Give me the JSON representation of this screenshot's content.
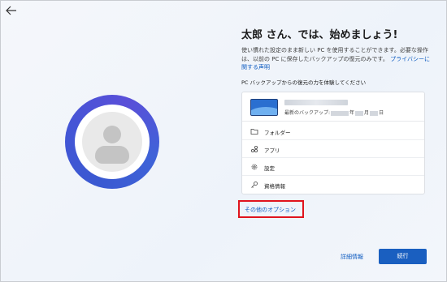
{
  "header": {
    "back_icon": "arrow-left-icon"
  },
  "main": {
    "title": "太郎 さん、では、始めましょう!",
    "description": "使い慣れた設定のまま新しい PC を使用することができます。必要な操作は、以前の PC に保存したバックアップの復元のみです。",
    "privacy_link": "プライバシーに関する声明",
    "section_label": "PC バックアップからの復元の力を体験してください"
  },
  "backup_card": {
    "backup_prefix": "最新のバックアップ:",
    "year_suffix": "年",
    "month_suffix": "月",
    "day_suffix": "日",
    "items": [
      {
        "label": "フォルダー",
        "icon": "folder-icon"
      },
      {
        "label": "アプリ",
        "icon": "apps-icon"
      },
      {
        "label": "設定",
        "icon": "gear-icon"
      },
      {
        "label": "資格情報",
        "icon": "key-icon"
      }
    ]
  },
  "actions": {
    "more_options": "その他のオプション",
    "details": "詳細情報",
    "next": "続行"
  },
  "colors": {
    "accent": "#1a5fc0",
    "link": "#0f5cc0",
    "highlight_border": "#e0141d",
    "avatar_ring": "#3a59d1"
  }
}
